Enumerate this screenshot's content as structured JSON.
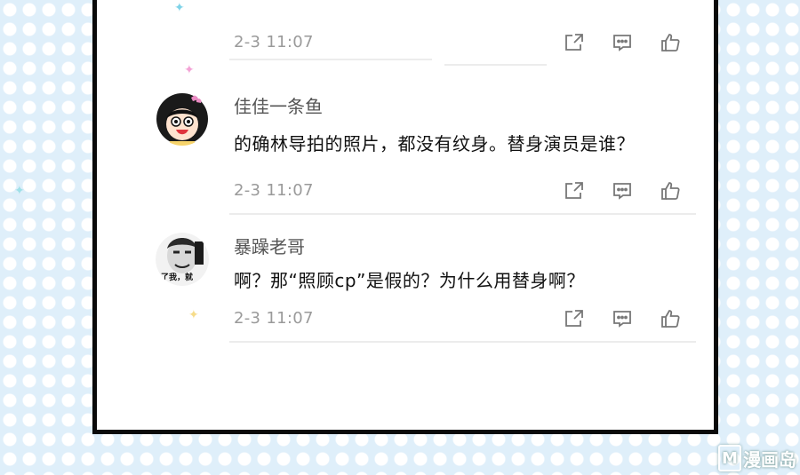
{
  "comments": [
    {
      "username": "",
      "text": "",
      "timestamp": "2-3 11:07"
    },
    {
      "username": "佳佳一条鱼",
      "text": "的确林导拍的照片，都没有纹身。替身演员是谁？",
      "timestamp": "2-3 11:07",
      "avatar_icon": "cartoon-girl-avatar-icon"
    },
    {
      "username": "暴躁老哥",
      "text": "啊？那“照顾cp”是假的？为什么用替身啊？",
      "timestamp": "2-3 11:07",
      "avatar_icon": "meme-face-avatar-icon",
      "avatar_caption": "了我，就"
    }
  ],
  "actions": [
    "share-icon",
    "comment-icon",
    "like-icon"
  ],
  "watermark": {
    "badge": "M",
    "text": "漫画岛"
  },
  "colors": {
    "panel_border": "#0a0a0a",
    "meta": "#9a9a9a",
    "background": "#dfeffa"
  }
}
